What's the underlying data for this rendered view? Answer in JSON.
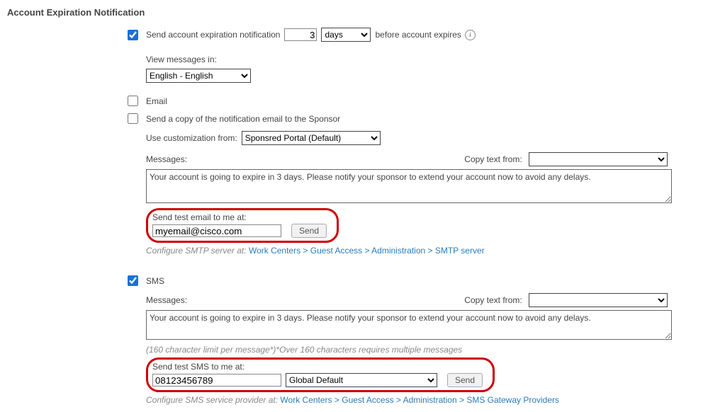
{
  "title": "Account Expiration Notification",
  "send_notification": {
    "label_pre": "Send account expiration notification",
    "value": "3",
    "unit_options": [
      "days"
    ],
    "unit_selected": "days",
    "label_post": "before account expires"
  },
  "view_messages_label": "View messages in:",
  "language_options": [
    "English - English"
  ],
  "language_selected": "English - English",
  "email": {
    "label": "Email",
    "send_copy_label": "Send a copy of the notification email to the Sponsor",
    "use_customization_label": "Use customization from:",
    "customization_options": [
      "Sponsred Portal (Default)"
    ],
    "customization_selected": "Sponsred Portal (Default)",
    "messages_label": "Messages:",
    "copy_text_from_label": "Copy text from:",
    "message_text": "Your account is going to expire in 3 days. Please notify your sponsor to extend your account now to avoid any delays.",
    "test_label": "Send test email to me at:",
    "test_value": "myemail@cisco.com",
    "send_btn": "Send",
    "config_prefix": "Configure SMTP server at:",
    "config_link": "Work Centers > Guest Access > Administration > SMTP server"
  },
  "sms": {
    "label": "SMS",
    "messages_label": "Messages:",
    "copy_text_from_label": "Copy text from:",
    "message_text": "Your account is going to expire in 3 days. Please notify your sponsor to extend your account now to avoid any delays.",
    "limit_note": "(160 character limit per message*)*Over 160 characters requires multiple messages",
    "test_label": "Send test SMS to me at:",
    "test_value": "08123456789",
    "provider_options": [
      "Global Default"
    ],
    "provider_selected": "Global Default",
    "send_btn": "Send",
    "config_prefix": "Configure SMS service provider at:",
    "config_link": "Work Centers > Guest Access > Administration > SMS Gateway Providers"
  }
}
